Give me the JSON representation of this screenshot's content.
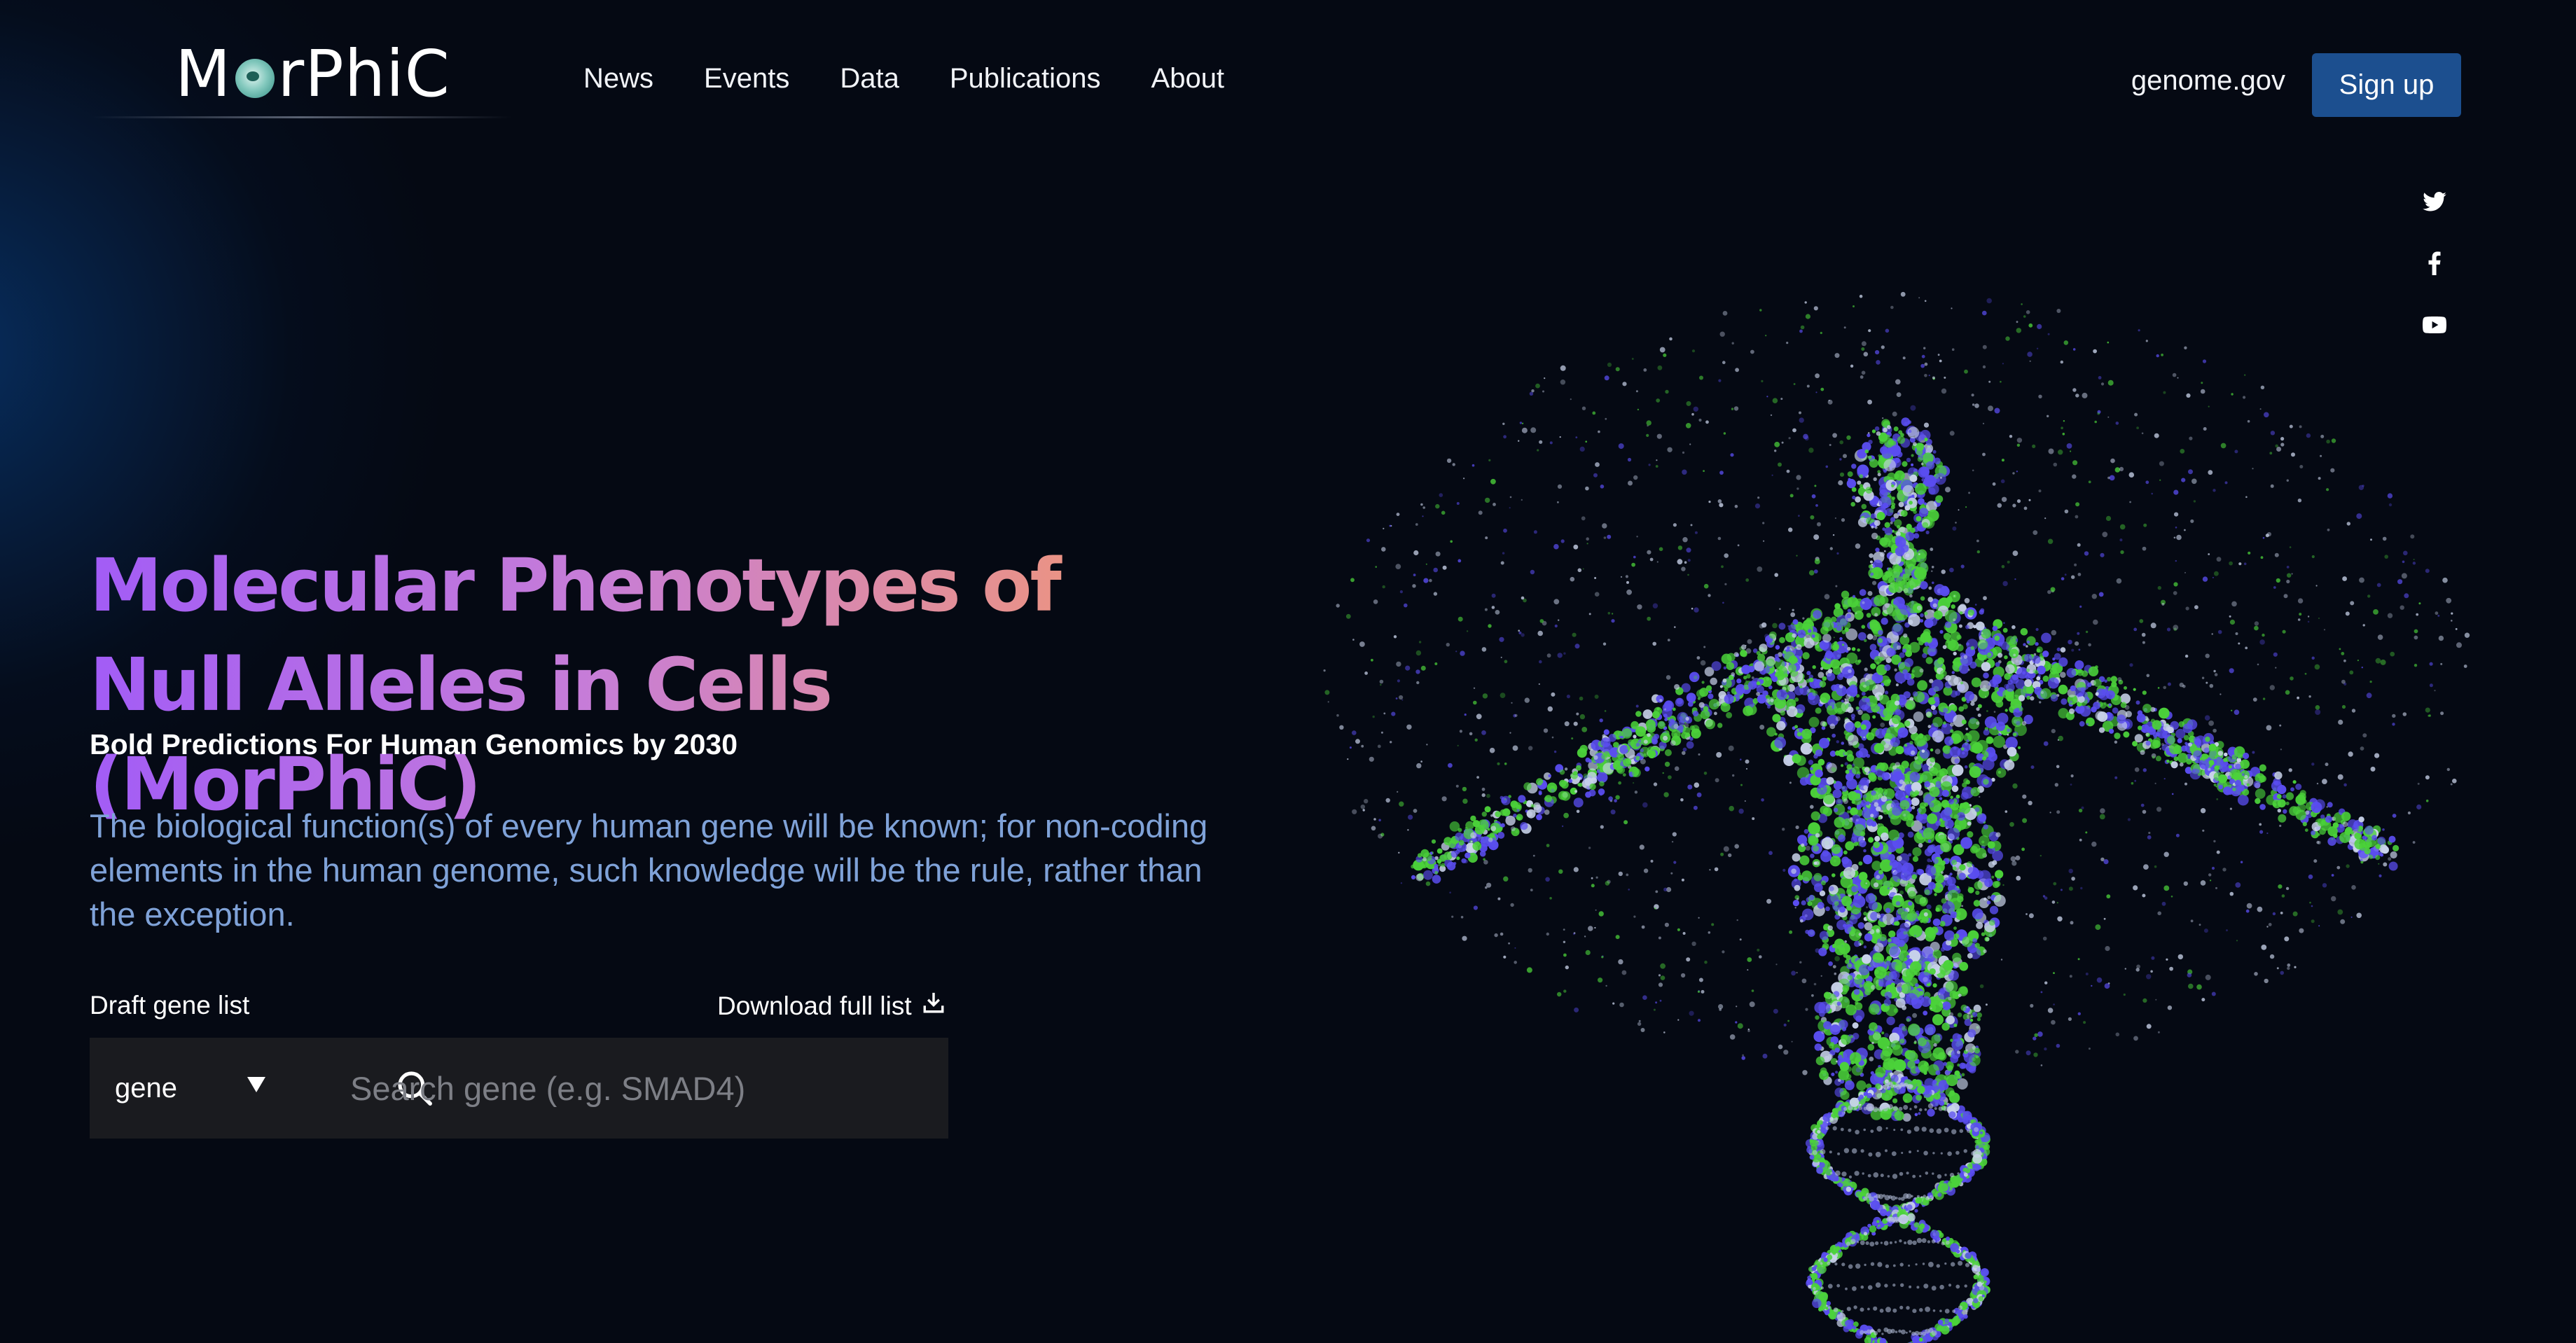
{
  "header": {
    "logo_text_left": "M",
    "logo_text_right": "rPhiC",
    "nav": [
      {
        "label": "News"
      },
      {
        "label": "Events"
      },
      {
        "label": "Data"
      },
      {
        "label": "Publications"
      },
      {
        "label": "About"
      }
    ],
    "external_link": "genome.gov",
    "signup_label": "Sign up"
  },
  "social": [
    {
      "icon": "twitter-icon"
    },
    {
      "icon": "facebook-icon"
    },
    {
      "icon": "youtube-icon"
    }
  ],
  "hero": {
    "title": "Molecular Phenotypes of Null Alleles in Cells (MorPhiC)",
    "subtitle": "Bold Predictions For Human Genomics by 2030",
    "description": "The biological function(s) of every human gene will be known; for non-coding elements in the human genome, such knowledge will be the rule, rather than the exception."
  },
  "search": {
    "label": "Draft gene list",
    "download_label": "Download full list",
    "select_value": "gene",
    "placeholder": "Search gene (e.g. SMAD4)"
  },
  "colors": {
    "background": "#050913",
    "accent_button": "#1c4f8f",
    "title_gradient_start": "#a25cf6",
    "title_gradient_end": "#f59a6c",
    "description": "#7fa2d8",
    "particle_green": "#4bd23a",
    "particle_blue": "#5a4df0"
  }
}
